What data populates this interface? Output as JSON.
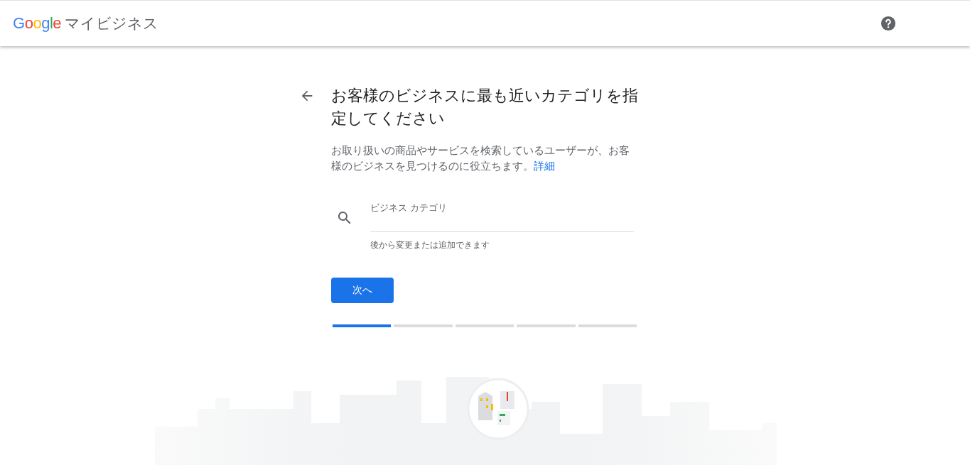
{
  "header": {
    "logo": "Google",
    "product": "マイビジネス"
  },
  "title": "お客様のビジネスに最も近いカテゴリを指定してください",
  "description": "お取り扱いの商品やサービスを検索しているユーザーが、お客様のビジネスを見つけるのに役立ちます。",
  "description_link": "詳細",
  "field": {
    "label": "ビジネス カテゴリ",
    "helper": "後から変更または追加できます"
  },
  "button": "次へ",
  "steps": [
    {
      "active": true
    },
    {
      "active": false
    },
    {
      "active": false
    },
    {
      "active": false
    },
    {
      "active": false
    }
  ]
}
